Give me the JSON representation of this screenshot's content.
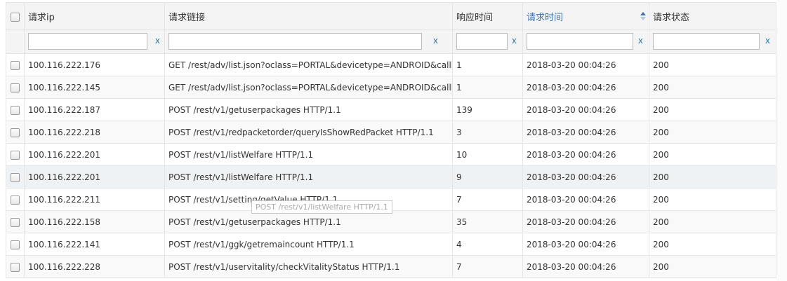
{
  "columns": {
    "ip": "请求ip",
    "url": "请求链接",
    "resp_time": "响应时间",
    "req_time": "请求时间",
    "status": "请求状态"
  },
  "filters": {
    "clear_label": "x",
    "ip": "",
    "url": "",
    "resp_time": "",
    "req_time": "",
    "status": ""
  },
  "sort": {
    "column": "req_time",
    "icon": "sort-icon"
  },
  "accent_color": "#3a73b8",
  "rows": [
    {
      "ip": "100.116.222.176",
      "url": "GET /rest/adv/list.json?oclass=PORTAL&devicetype=ANDROID&callb",
      "resp_time": "1",
      "req_time": "2018-03-20 00:04:26",
      "status": "200"
    },
    {
      "ip": "100.116.222.145",
      "url": "GET /rest/adv/list.json?oclass=PORTAL&devicetype=ANDROID&callb",
      "resp_time": "1",
      "req_time": "2018-03-20 00:04:26",
      "status": "200"
    },
    {
      "ip": "100.116.222.187",
      "url": "POST /rest/v1/getuserpackages HTTP/1.1",
      "resp_time": "139",
      "req_time": "2018-03-20 00:04:26",
      "status": "200"
    },
    {
      "ip": "100.116.222.218",
      "url": "POST /rest/v1/redpacketorder/queryIsShowRedPacket HTTP/1.1",
      "resp_time": "3",
      "req_time": "2018-03-20 00:04:26",
      "status": "200"
    },
    {
      "ip": "100.116.222.201",
      "url": "POST /rest/v1/listWelfare HTTP/1.1",
      "resp_time": "10",
      "req_time": "2018-03-20 00:04:26",
      "status": "200"
    },
    {
      "ip": "100.116.222.201",
      "url": "POST /rest/v1/listWelfare HTTP/1.1",
      "resp_time": "9",
      "req_time": "2018-03-20 00:04:26",
      "status": "200"
    },
    {
      "ip": "100.116.222.211",
      "url": "POST /rest/v1/setting/getValue HTTP/1.1",
      "resp_time": "7",
      "req_time": "2018-03-20 00:04:26",
      "status": "200"
    },
    {
      "ip": "100.116.222.158",
      "url": "POST /rest/v1/getuserpackages HTTP/1.1",
      "resp_time": "35",
      "req_time": "2018-03-20 00:04:26",
      "status": "200"
    },
    {
      "ip": "100.116.222.141",
      "url": "POST /rest/v1/ggk/getremaincount HTTP/1.1",
      "resp_time": "4",
      "req_time": "2018-03-20 00:04:26",
      "status": "200"
    },
    {
      "ip": "100.116.222.228",
      "url": "POST /rest/v1/uservitality/checkVitalityStatus HTTP/1.1",
      "resp_time": "7",
      "req_time": "2018-03-20 00:04:26",
      "status": "200"
    }
  ],
  "tooltip": "POST /rest/v1/listWelfare HTTP/1.1"
}
